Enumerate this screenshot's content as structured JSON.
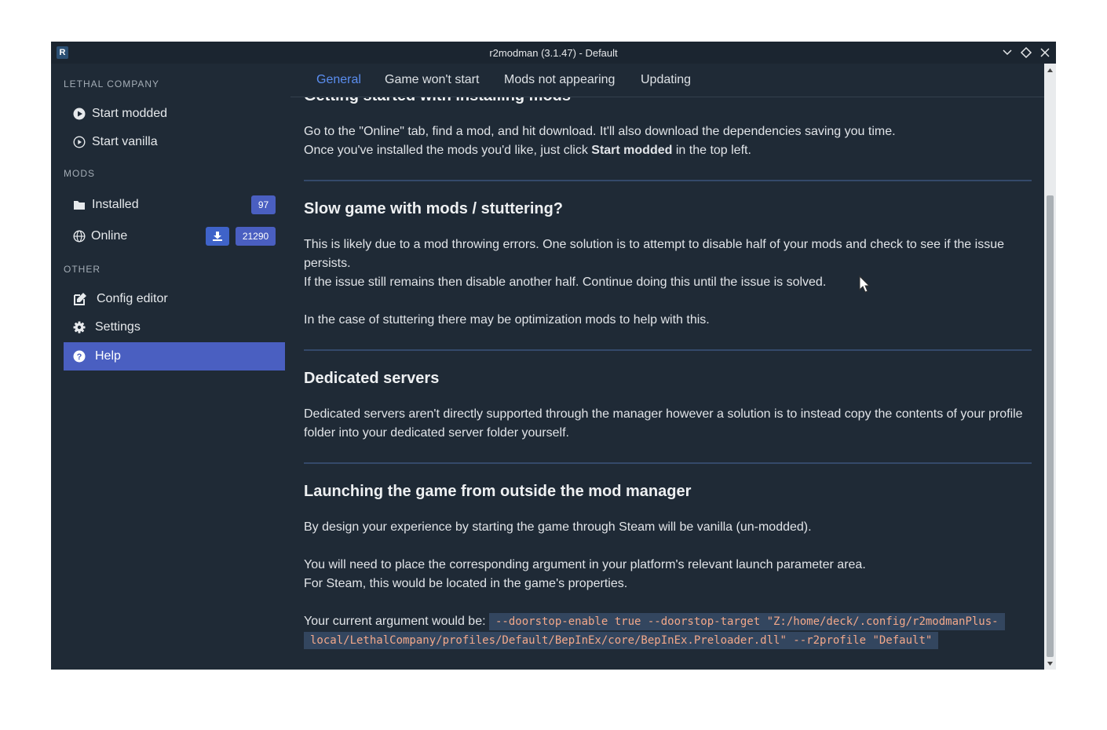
{
  "window": {
    "title": "r2modman (3.1.47) - Default",
    "logo_letter": "R"
  },
  "sidebar": {
    "game_section": "LETHAL COMPANY",
    "start_modded": "Start modded",
    "start_vanilla": "Start vanilla",
    "mods_section": "MODS",
    "installed": {
      "label": "Installed",
      "count": "97"
    },
    "online": {
      "label": "Online",
      "count": "21290"
    },
    "other_section": "OTHER",
    "config_editor": "Config editor",
    "settings": "Settings",
    "help": "Help"
  },
  "tabs": [
    "General",
    "Game won't start",
    "Mods not appearing",
    "Updating"
  ],
  "active_tab": "General",
  "sections": {
    "getting_started": {
      "heading": "Getting started with installing mods",
      "line1": "Go to the \"Online\" tab, find a mod, and hit download. It'll also download the dependencies saving you time.",
      "line2_pre": "Once you've installed the mods you'd like, just click ",
      "line2_bold": "Start modded",
      "line2_post": " in the top left."
    },
    "slow_game": {
      "heading": "Slow game with mods / stuttering?",
      "para1": "This is likely due to a mod throwing errors. One solution is to attempt to disable half of your mods and check to see if the issue persists.",
      "para2": "If the issue still remains then disable another half. Continue doing this until the issue is solved.",
      "para3": "In the case of stuttering there may be optimization mods to help with this."
    },
    "dedicated": {
      "heading": "Dedicated servers",
      "para": "Dedicated servers aren't directly supported through the manager however a solution is to instead copy the contents of your profile folder into your dedicated server folder yourself."
    },
    "launching": {
      "heading": "Launching the game from outside the mod manager",
      "para1": "By design your experience by starting the game through Steam will be vanilla (un-modded).",
      "para2": "You will need to place the corresponding argument in your platform's relevant launch parameter area.",
      "para3": "For Steam, this would be located in the game's properties.",
      "arg_label": "Your current argument would be: ",
      "arg_value": "--doorstop-enable true --doorstop-target \"Z:/home/deck/.config/r2modmanPlus-local/LethalCompany/profiles/Default/BepInEx/core/BepInEx.Preloader.dll\" --r2profile \"Default\""
    }
  },
  "colors": {
    "accent": "#4a5fc1",
    "tab_active": "#5b8ef0",
    "background": "#1f2a36",
    "code_text": "#f2a88a"
  },
  "icons": [
    "play-circle-icon",
    "folder-icon",
    "globe-icon",
    "download-icon",
    "edit-icon",
    "gear-icon",
    "question-circle-icon",
    "minimize-icon",
    "maximize-icon",
    "close-icon"
  ]
}
